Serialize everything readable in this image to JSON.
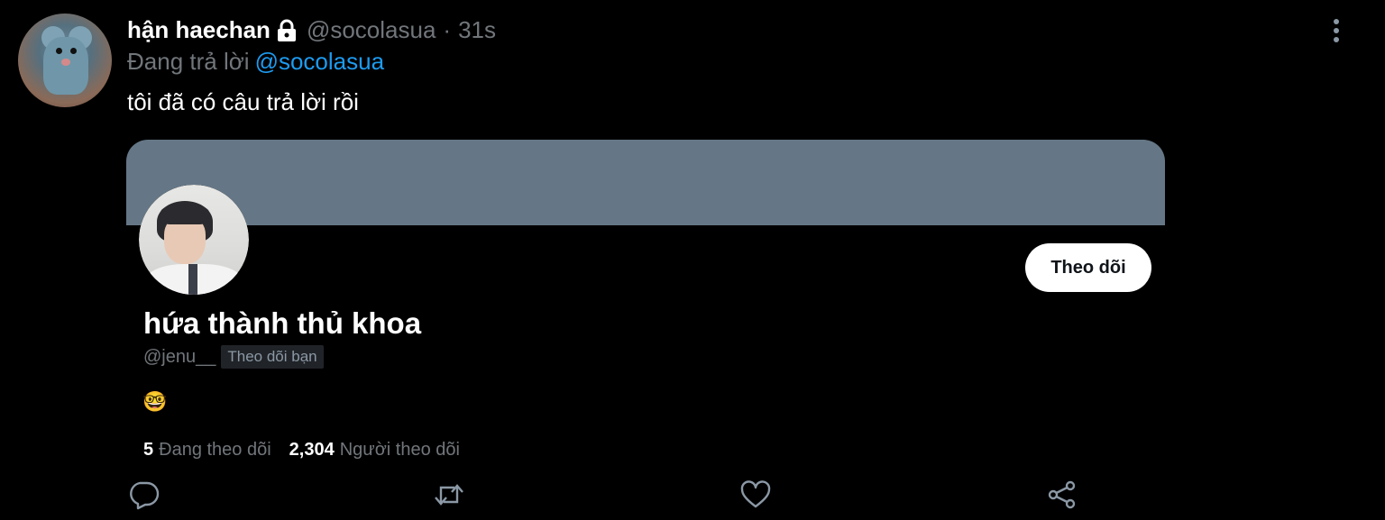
{
  "tweet": {
    "display_name": "hận haechan",
    "handle": "@socolasua",
    "separator": "·",
    "time": "31s",
    "reply_prefix": "Đang trả lời",
    "reply_to": "@socolasua",
    "text": "tôi đã có câu trả lời rồi"
  },
  "card": {
    "banner_color": "#657786",
    "name": "hứa thành thủ khoa",
    "handle": "@jenu__",
    "follows_you_label": "Theo dõi bạn",
    "bio": "🤓",
    "follow_button_label": "Theo dõi",
    "following_count": "5",
    "following_label": "Đang theo dõi",
    "followers_count": "2,304",
    "followers_label": "Người theo dõi"
  },
  "actions": {
    "icons": [
      "reply-icon",
      "retweet-icon",
      "like-icon",
      "share-icon"
    ]
  },
  "colors": {
    "background": "#000000",
    "muted_text": "#71767b",
    "link": "#1d9bf0",
    "icon": "#8b98a5"
  }
}
